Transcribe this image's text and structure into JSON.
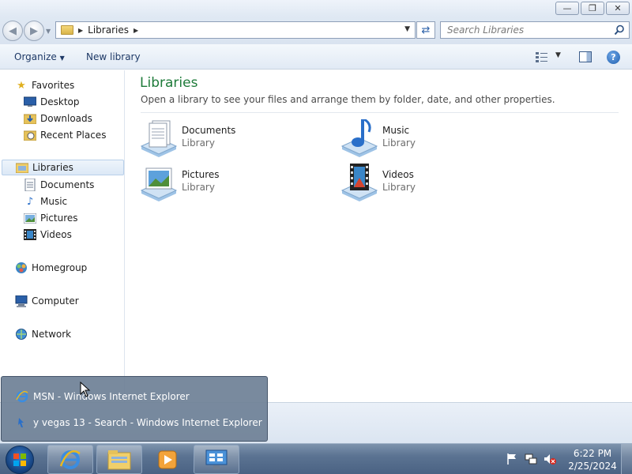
{
  "window": {
    "minimize_icon": "minimize-icon",
    "maximize_icon": "restore-icon",
    "close_icon": "close-icon"
  },
  "address": {
    "path_label": "Libraries",
    "search_placeholder": "Search Libraries"
  },
  "toolbar": {
    "organize_label": "Organize",
    "new_library_label": "New library"
  },
  "sidebar": {
    "favorites": {
      "label": "Favorites",
      "items": [
        {
          "label": "Desktop"
        },
        {
          "label": "Downloads"
        },
        {
          "label": "Recent Places"
        }
      ]
    },
    "libraries": {
      "label": "Libraries",
      "items": [
        {
          "label": "Documents"
        },
        {
          "label": "Music"
        },
        {
          "label": "Pictures"
        },
        {
          "label": "Videos"
        }
      ]
    },
    "homegroup": {
      "label": "Homegroup"
    },
    "computer": {
      "label": "Computer"
    },
    "network": {
      "label": "Network"
    }
  },
  "main": {
    "title": "Libraries",
    "description": "Open a library to see your files and arrange them by folder, date, and other properties.",
    "libraries": [
      {
        "name": "Documents",
        "type": "Library",
        "icon": "documents-library-icon"
      },
      {
        "name": "Music",
        "type": "Library",
        "icon": "music-library-icon"
      },
      {
        "name": "Pictures",
        "type": "Library",
        "icon": "pictures-library-icon"
      },
      {
        "name": "Videos",
        "type": "Library",
        "icon": "videos-library-icon"
      }
    ]
  },
  "popup": {
    "items": [
      {
        "label": "MSN - Windows Internet Explorer"
      },
      {
        "label": "y vegas 13 - Search - Windows Internet Explorer"
      }
    ]
  },
  "taskbar": {
    "apps": [
      "internet-explorer-icon",
      "windows-explorer-icon",
      "media-player-icon",
      "control-panel-icon"
    ],
    "clock_time": "6:22 PM",
    "clock_date": "2/25/2024"
  },
  "colors": {
    "title_green": "#1e7b3a",
    "link_blue": "#1e3966",
    "taskbar": "#4a6283"
  }
}
